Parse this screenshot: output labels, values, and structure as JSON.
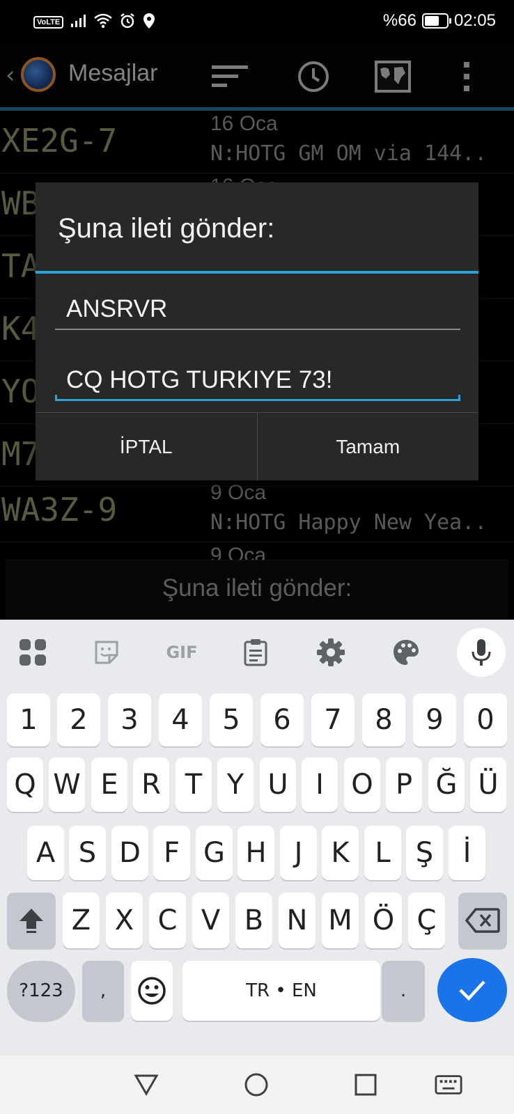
{
  "status_bar": {
    "network_badge": "VoLTE",
    "battery_percent": "%66",
    "battery_level": 0.66,
    "time": "02:05",
    "icons": [
      "signal-icon",
      "wifi-icon",
      "alarm-icon",
      "location-icon",
      "battery-icon"
    ]
  },
  "app_bar": {
    "title": "Mesajlar",
    "icons": [
      "back-icon",
      "app-logo",
      "sort-icon",
      "clock-icon",
      "map-icon",
      "more-vertical-icon"
    ]
  },
  "messages": [
    {
      "callsign": "XE2G-7",
      "date": "16 Oca",
      "text": "N:HOTG GM OM via 144.."
    },
    {
      "callsign": "WB",
      "date": "16 Oca",
      "text": ""
    },
    {
      "callsign": "TA",
      "date": "",
      "text": ""
    },
    {
      "callsign": "K4",
      "date": "",
      "text": ""
    },
    {
      "callsign": "YO",
      "date": "",
      "text": ""
    },
    {
      "callsign": "M7",
      "date": "",
      "text": ""
    },
    {
      "callsign": "WA3Z-9",
      "date": "9 Oca",
      "text": "N:HOTG Happy New Yea.."
    },
    {
      "callsign": "",
      "date": "9 Oca",
      "text": ""
    }
  ],
  "bottom_field": {
    "label": "Şuna ileti gönder:"
  },
  "dialog": {
    "title": "Şuna ileti gönder:",
    "recipient_value": "ANSRVR",
    "message_value": "CQ HOTG TURKIYE 73!",
    "cancel_label": "İPTAL",
    "ok_label": "Tamam"
  },
  "keyboard": {
    "toolbar": [
      "apps-grid-icon",
      "sticker-icon",
      "GIF",
      "clipboard-icon",
      "settings-gear-icon",
      "palette-icon",
      "microphone-icon"
    ],
    "row_numbers": [
      "1",
      "2",
      "3",
      "4",
      "5",
      "6",
      "7",
      "8",
      "9",
      "0"
    ],
    "row_1": [
      "Q",
      "W",
      "E",
      "R",
      "T",
      "Y",
      "U",
      "I",
      "O",
      "P",
      "Ğ",
      "Ü"
    ],
    "row_2": [
      "A",
      "S",
      "D",
      "F",
      "G",
      "H",
      "J",
      "K",
      "L",
      "Ş",
      "İ"
    ],
    "row_3": [
      "Z",
      "X",
      "C",
      "V",
      "B",
      "N",
      "M",
      "Ö",
      "Ç"
    ],
    "symbols_label": "?123",
    "comma": ",",
    "space_label": "TR • EN",
    "period": ".",
    "accent_color": "#1a73e8"
  },
  "nav_bar": {
    "icons": [
      "back-triangle-icon",
      "home-circle-icon",
      "recents-square-icon",
      "keyboard-switch-icon"
    ]
  }
}
